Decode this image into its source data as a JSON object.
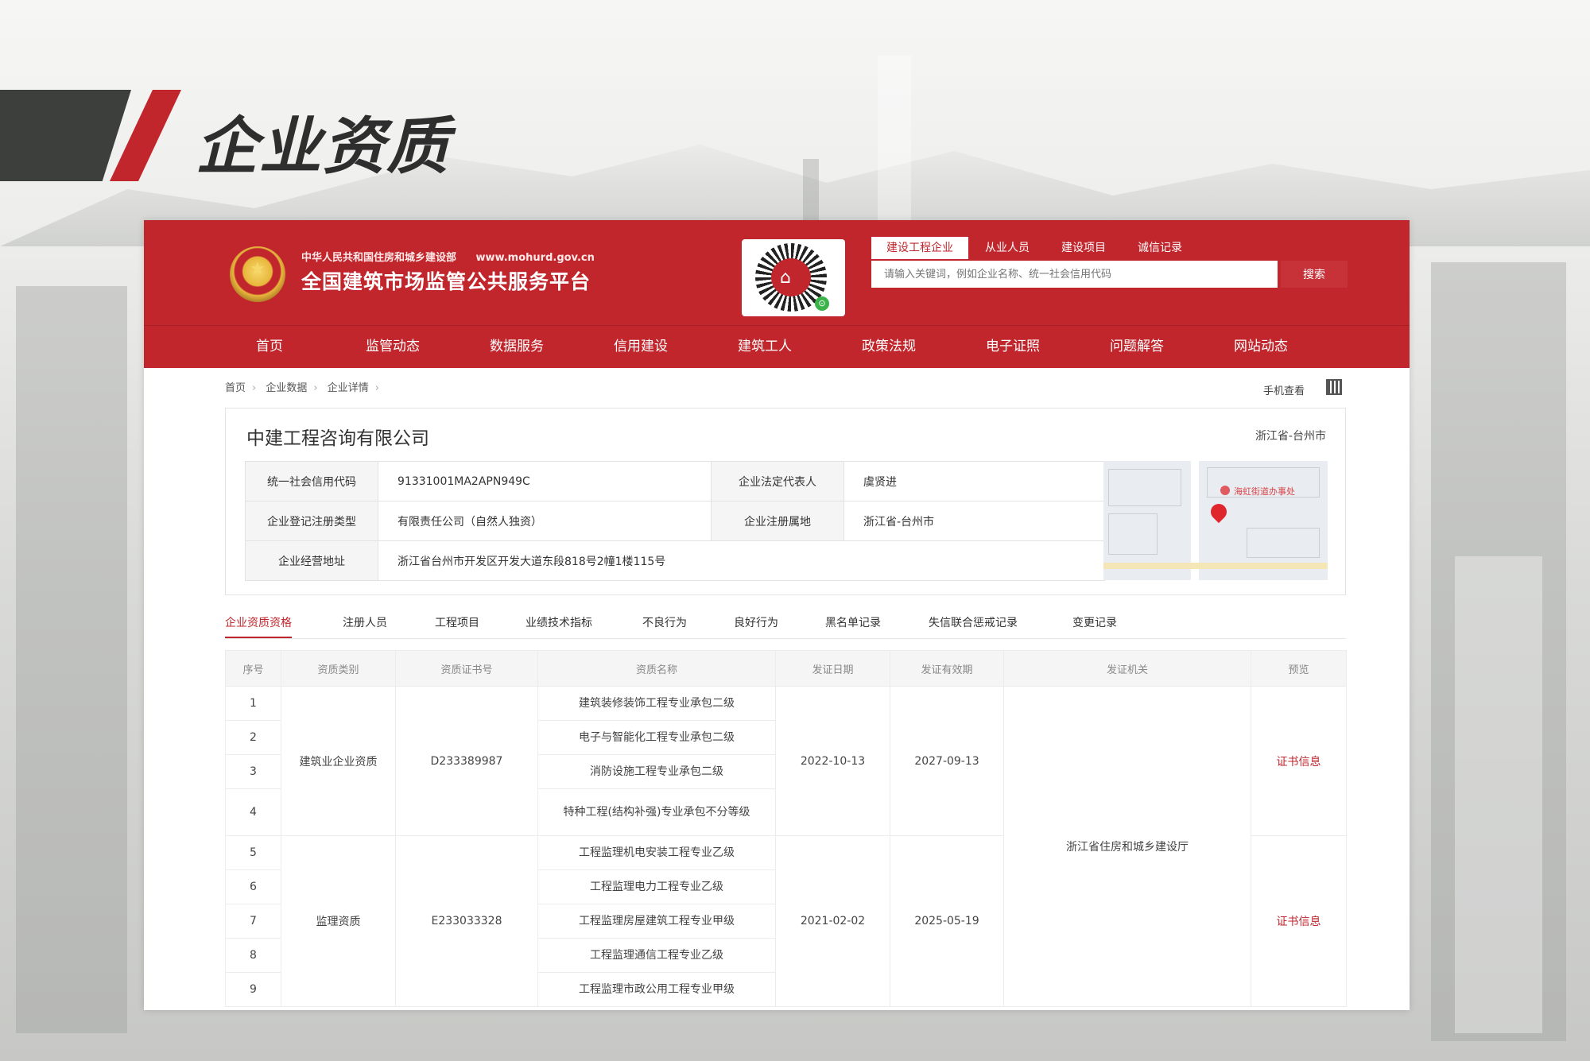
{
  "slide": {
    "title": "企业资质"
  },
  "header": {
    "ministry": "中华人民共和国住房和城乡建设部",
    "ministry_url": "www.mohurd.gov.cn",
    "platform": "全国建筑市场监管公共服务平台"
  },
  "search": {
    "tabs": [
      "建设工程企业",
      "从业人员",
      "建设项目",
      "诚信记录"
    ],
    "active_tab": 0,
    "placeholder": "请输入关键词，例如企业名称、统一社会信用代码",
    "button": "搜索"
  },
  "nav": [
    "首页",
    "监管动态",
    "数据服务",
    "信用建设",
    "建筑工人",
    "政策法规",
    "电子证照",
    "问题解答",
    "网站动态"
  ],
  "breadcrumb": [
    "首页",
    "企业数据",
    "企业详情"
  ],
  "mobile_view": "手机查看",
  "company": {
    "name": "中建工程咨询有限公司",
    "region": "浙江省-台州市",
    "labels": {
      "credit_code": "统一社会信用代码",
      "legal_rep": "企业法定代表人",
      "reg_type": "企业登记注册类型",
      "reg_place": "企业注册属地",
      "address": "企业经营地址"
    },
    "credit_code": "91331001MA2APN949C",
    "legal_rep": "虞贤进",
    "reg_type": "有限责任公司（自然人独资）",
    "reg_place": "浙江省-台州市",
    "address": "浙江省台州市开发区开发大道东段818号2幢1楼115号",
    "map_label": "海虹街道办事处"
  },
  "tabs": [
    "企业资质资格",
    "注册人员",
    "工程项目",
    "业绩技术指标",
    "不良行为",
    "良好行为",
    "黑名单记录",
    "失信联合惩戒记录",
    "变更记录"
  ],
  "qual_table": {
    "headers": [
      "序号",
      "资质类别",
      "资质证书号",
      "资质名称",
      "发证日期",
      "发证有效期",
      "发证机关",
      "预览"
    ],
    "groups": [
      {
        "category": "建筑业企业资质",
        "cert_no": "D233389987",
        "issue_date": "2022-10-13",
        "valid_until": "2027-09-13",
        "preview": "证书信息",
        "items": [
          {
            "no": "1",
            "name": "建筑装修装饰工程专业承包二级"
          },
          {
            "no": "2",
            "name": "电子与智能化工程专业承包二级"
          },
          {
            "no": "3",
            "name": "消防设施工程专业承包二级"
          },
          {
            "no": "4",
            "name": "特种工程(结构补强)专业承包不分等级"
          }
        ]
      },
      {
        "category": "监理资质",
        "cert_no": "E233033328",
        "issue_date": "2021-02-02",
        "valid_until": "2025-05-19",
        "preview": "证书信息",
        "items": [
          {
            "no": "5",
            "name": "工程监理机电安装工程专业乙级"
          },
          {
            "no": "6",
            "name": "工程监理电力工程专业乙级"
          },
          {
            "no": "7",
            "name": "工程监理房屋建筑工程专业甲级"
          },
          {
            "no": "8",
            "name": "工程监理通信工程专业乙级"
          },
          {
            "no": "9",
            "name": "工程监理市政公用工程专业甲级"
          }
        ]
      }
    ],
    "authority": "浙江省住房和城乡建设厅"
  },
  "colors": {
    "brand_red": "#c1262d",
    "heading_dark": "#3c3f3c"
  },
  "icons": {
    "emblem": "national-emblem-icon",
    "qr": "qr-code-icon",
    "mobile": "qr-mini-icon",
    "map_pin": "map-pin-icon"
  }
}
